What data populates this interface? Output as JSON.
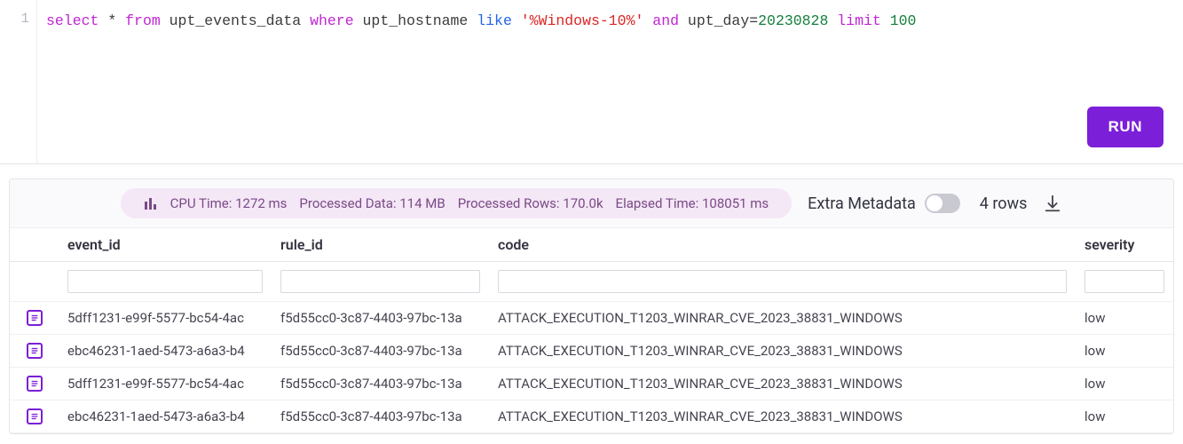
{
  "editor": {
    "line_number": "1",
    "tokens": {
      "select": "select",
      "star": "*",
      "from": "from",
      "table": "upt_events_data",
      "where": "where",
      "col_host": "upt_hostname",
      "like": "like",
      "str_host": "'%Windows-10%'",
      "and": "and",
      "col_day": "upt_day",
      "eq": "=",
      "num_day": "20230828",
      "limit": "limit",
      "num_limit": "100"
    },
    "run_label": "RUN"
  },
  "stats": {
    "cpu_label": "CPU Time:",
    "cpu_value": "1272 ms",
    "pdata_label": "Processed Data:",
    "pdata_value": "114 MB",
    "prows_label": "Processed Rows:",
    "prows_value": "170.0k",
    "etime_label": "Elapsed Time:",
    "etime_value": "108051 ms",
    "extra_meta_label": "Extra Metadata",
    "row_count": "4 rows"
  },
  "columns": {
    "event_id": "event_id",
    "rule_id": "rule_id",
    "code": "code",
    "severity": "severity"
  },
  "rows": [
    {
      "event_id": "5dff1231-e99f-5577-bc54-4ac",
      "rule_id": "f5d55cc0-3c87-4403-97bc-13a",
      "code": "ATTACK_EXECUTION_T1203_WINRAR_CVE_2023_38831_WINDOWS",
      "severity": "low"
    },
    {
      "event_id": "ebc46231-1aed-5473-a6a3-b4",
      "rule_id": "f5d55cc0-3c87-4403-97bc-13a",
      "code": "ATTACK_EXECUTION_T1203_WINRAR_CVE_2023_38831_WINDOWS",
      "severity": "low"
    },
    {
      "event_id": "5dff1231-e99f-5577-bc54-4ac",
      "rule_id": "f5d55cc0-3c87-4403-97bc-13a",
      "code": "ATTACK_EXECUTION_T1203_WINRAR_CVE_2023_38831_WINDOWS",
      "severity": "low"
    },
    {
      "event_id": "ebc46231-1aed-5473-a6a3-b4",
      "rule_id": "f5d55cc0-3c87-4403-97bc-13a",
      "code": "ATTACK_EXECUTION_T1203_WINRAR_CVE_2023_38831_WINDOWS",
      "severity": "low"
    }
  ]
}
